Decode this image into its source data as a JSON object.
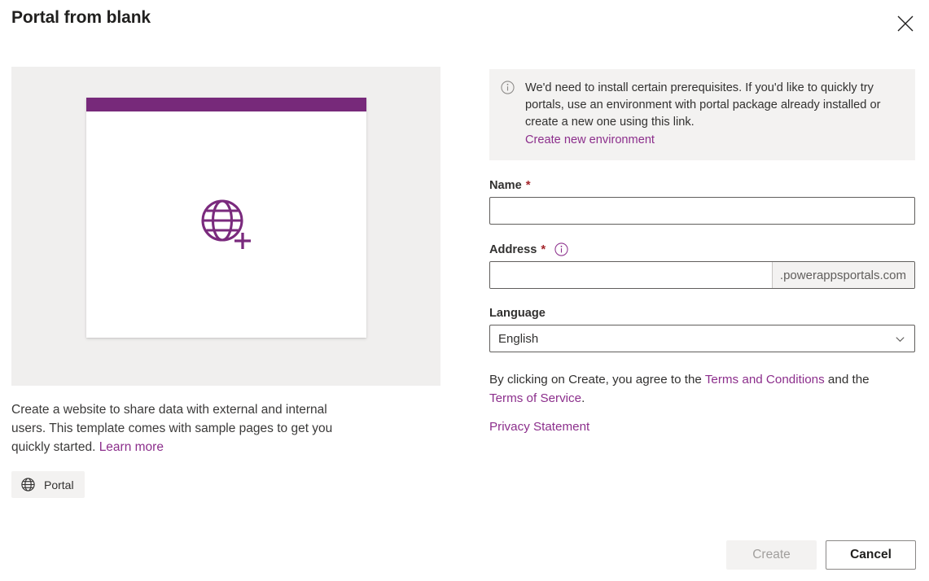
{
  "dialog": {
    "title": "Portal from blank",
    "close_icon": "close-icon"
  },
  "left": {
    "preview": {
      "card_icon": "globe-plus-icon",
      "accent_color": "#77297a",
      "background_color": "#f0efee"
    },
    "description": {
      "text_part_1": "Create a website to share data with external and internal users. This template comes with sample pages to get you quickly started. ",
      "learn_more_label": "Learn more"
    },
    "tag": {
      "icon": "globe-icon",
      "label": "Portal"
    }
  },
  "right": {
    "info_banner": {
      "icon": "info-circle-icon",
      "message": "We'd need to install certain prerequisites. If you'd like to quickly try portals, use an environment with portal package already installed or create a new one using this link.",
      "link_label": "Create new environment"
    },
    "fields": {
      "name": {
        "label": "Name",
        "required_marker": "*",
        "value": "",
        "placeholder": ""
      },
      "address": {
        "label": "Address",
        "required_marker": "*",
        "info_icon": "info-circle-icon",
        "value": "",
        "placeholder": "",
        "suffix": ".powerappsportals.com"
      },
      "language": {
        "label": "Language",
        "selected": "English",
        "chevron_icon": "chevron-down-icon",
        "options": [
          "English"
        ]
      }
    },
    "terms": {
      "prefix": "By clicking on Create, you agree to the ",
      "terms_and_conditions_label": "Terms and Conditions",
      "middle": " and the ",
      "terms_of_service_label": "Terms of Service",
      "suffix": ".",
      "privacy_statement_label": "Privacy Statement"
    }
  },
  "footer": {
    "create_label": "Create",
    "cancel_label": "Cancel"
  },
  "colors": {
    "accent_purple": "#77297a",
    "link_purple": "#8c2f8c",
    "required_red": "#a4262c",
    "neutral_light": "#f3f2f1"
  }
}
